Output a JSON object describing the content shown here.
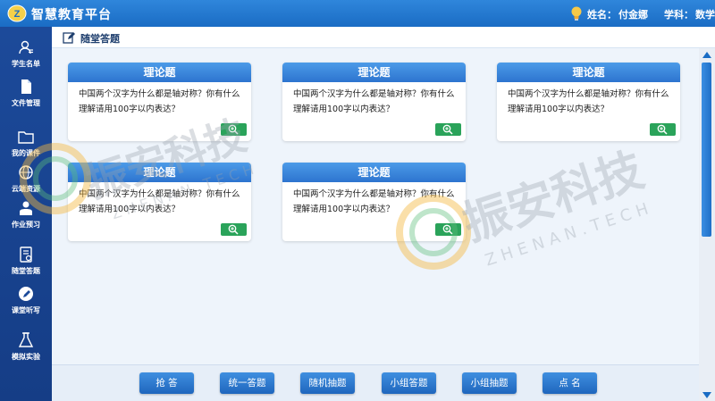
{
  "header": {
    "app_title": "智慧教育平台",
    "name_label": "姓名：",
    "name_value": "付金娜",
    "subject_label": "学科：",
    "subject_value": "数学"
  },
  "sidebar": {
    "items": [
      {
        "label": "学生名单",
        "icon": "student-list-icon"
      },
      {
        "label": "文件管理",
        "icon": "file-icon"
      },
      {
        "label": "我的课件",
        "icon": "folder-icon"
      },
      {
        "label": "云端资源",
        "icon": "cloud-globe-icon"
      },
      {
        "label": "作业预习",
        "icon": "homework-icon"
      },
      {
        "label": "随堂答题",
        "icon": "quiz-icon"
      },
      {
        "label": "课堂听写",
        "icon": "dictation-icon"
      },
      {
        "label": "模拟实验",
        "icon": "flask-icon"
      }
    ]
  },
  "page": {
    "title": "随堂答题"
  },
  "cards": [
    {
      "type": "理论题",
      "question": "中国两个汉字为什么都是轴对称？你有什么理解请用100字以内表达？"
    },
    {
      "type": "理论题",
      "question": "中国两个汉字为什么都是轴对称？你有什么理解请用100字以内表达？"
    },
    {
      "type": "理论题",
      "question": "中国两个汉字为什么都是轴对称？你有什么理解请用100字以内表达？"
    },
    {
      "type": "理论题",
      "question": "中国两个汉字为什么都是轴对称？你有什么理解请用100字以内表达？"
    },
    {
      "type": "理论题",
      "question": "中国两个汉字为什么都是轴对称？你有什么理解请用100字以内表达？"
    }
  ],
  "bottom_buttons": [
    "抢 答",
    "统一答题",
    "随机抽题",
    "小组答题",
    "小组抽题",
    "点 名"
  ],
  "watermark": {
    "brand": "振安科技",
    "domain": "ZHENAN.TECH"
  },
  "colors": {
    "primary": "#1a6cc4",
    "sidebar": "#1c4a9a",
    "zoom": "#2aa35a",
    "accent": "#f5b940"
  }
}
